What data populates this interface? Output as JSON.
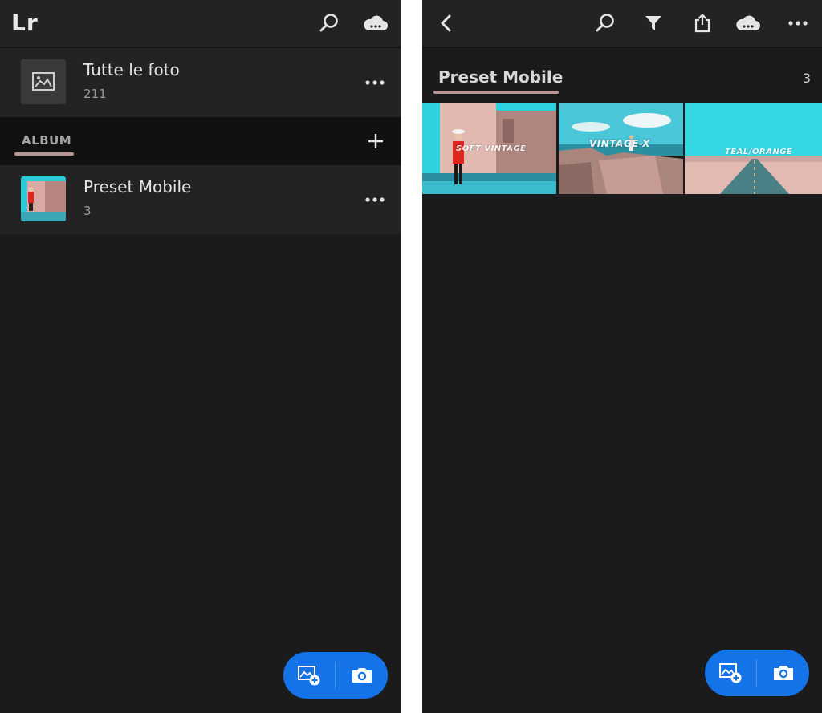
{
  "left": {
    "logo": "Lr",
    "all_photos": {
      "title": "Tutte le foto",
      "count": "211"
    },
    "section_label": "ALBUM",
    "album": {
      "title": "Preset Mobile",
      "count": "3"
    }
  },
  "right": {
    "album_title": "Preset Mobile",
    "album_count": "3",
    "photos": [
      {
        "label": "SOFT VINTAGE"
      },
      {
        "label": "VINTAGE-X"
      },
      {
        "label": "TEAL/ORANGE"
      }
    ]
  },
  "colors": {
    "background": "#1b1b1c",
    "toolbar": "#232324",
    "accent_blue": "#1473e6",
    "highlight_underline": "#b89595"
  },
  "icons": [
    "search-icon",
    "cloud-icon",
    "more-icon",
    "plus-icon",
    "back-icon",
    "filter-icon",
    "share-icon",
    "add-photo-icon",
    "camera-icon",
    "image-icon"
  ]
}
